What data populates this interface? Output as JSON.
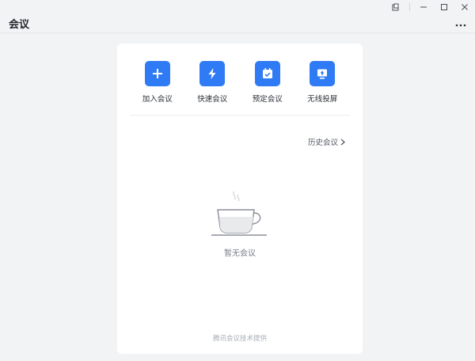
{
  "header": {
    "title": "会议"
  },
  "window_controls": [
    "pin-icon",
    "minimize-icon",
    "maximize-icon",
    "close-icon"
  ],
  "actions": [
    {
      "label": "加入会议",
      "icon": "plus-icon"
    },
    {
      "label": "快速会议",
      "icon": "lightning-icon"
    },
    {
      "label": "预定会议",
      "icon": "calendar-check-icon"
    },
    {
      "label": "无线投屏",
      "icon": "screen-share-icon"
    }
  ],
  "history": {
    "label": "历史会议"
  },
  "empty": {
    "text": "暂无会议",
    "icon": "coffee-cup-icon"
  },
  "footer": {
    "text": "腾讯会议技术提供"
  },
  "colors": {
    "accent": "#2f7bf5",
    "background": "#f2f3f5",
    "card": "#ffffff"
  }
}
